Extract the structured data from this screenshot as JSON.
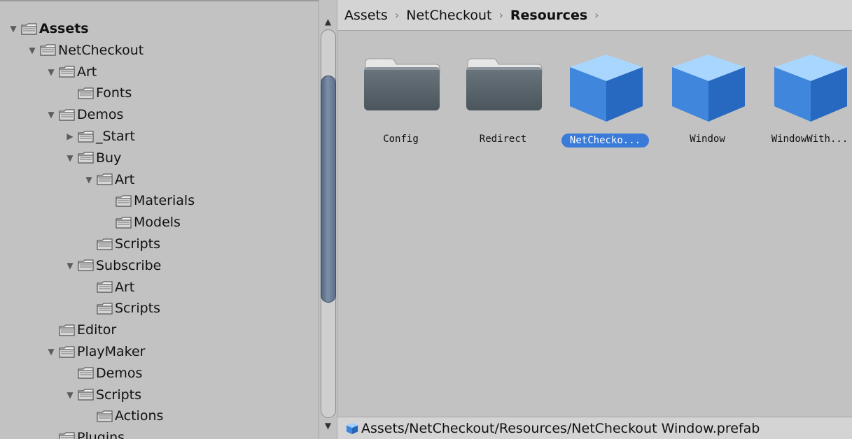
{
  "tree": {
    "items": [
      {
        "label": "Assets",
        "depth": 0,
        "expander": "expanded",
        "bold": true
      },
      {
        "label": "NetCheckout",
        "depth": 1,
        "expander": "expanded"
      },
      {
        "label": "Art",
        "depth": 2,
        "expander": "expanded"
      },
      {
        "label": "Fonts",
        "depth": 3,
        "expander": "none"
      },
      {
        "label": "Demos",
        "depth": 2,
        "expander": "expanded"
      },
      {
        "label": "_Start",
        "depth": 3,
        "expander": "collapsed"
      },
      {
        "label": "Buy",
        "depth": 3,
        "expander": "expanded"
      },
      {
        "label": "Art",
        "depth": 4,
        "expander": "expanded"
      },
      {
        "label": "Materials",
        "depth": 5,
        "expander": "none"
      },
      {
        "label": "Models",
        "depth": 5,
        "expander": "none"
      },
      {
        "label": "Scripts",
        "depth": 4,
        "expander": "none"
      },
      {
        "label": "Subscribe",
        "depth": 3,
        "expander": "expanded"
      },
      {
        "label": "Art",
        "depth": 4,
        "expander": "none"
      },
      {
        "label": "Scripts",
        "depth": 4,
        "expander": "none"
      },
      {
        "label": "Editor",
        "depth": 2,
        "expander": "none"
      },
      {
        "label": "PlayMaker",
        "depth": 2,
        "expander": "expanded"
      },
      {
        "label": "Demos",
        "depth": 3,
        "expander": "none"
      },
      {
        "label": "Scripts",
        "depth": 3,
        "expander": "expanded"
      },
      {
        "label": "Actions",
        "depth": 4,
        "expander": "none"
      },
      {
        "label": "Plugins",
        "depth": 2,
        "expander": "none"
      }
    ]
  },
  "breadcrumb": {
    "items": [
      {
        "label": "Assets",
        "current": false
      },
      {
        "label": "NetCheckout",
        "current": false
      },
      {
        "label": "Resources",
        "current": true
      }
    ],
    "separator": "›"
  },
  "assets": [
    {
      "label": "Config",
      "icon": "folder-icon",
      "selected": false
    },
    {
      "label": "Redirect",
      "icon": "folder-icon",
      "selected": false
    },
    {
      "label": "NetChecko...",
      "icon": "prefab-cube-icon",
      "selected": true
    },
    {
      "label": "Window",
      "icon": "prefab-cube-icon",
      "selected": false
    },
    {
      "label": "WindowWith...",
      "icon": "prefab-cube-icon",
      "selected": false
    }
  ],
  "status": {
    "path": "Assets/NetCheckout/Resources/NetCheckout Window.prefab",
    "icon": "prefab-cube-icon"
  },
  "scrollbar": {
    "up_glyph": "▲",
    "down_glyph": "▼"
  },
  "colors": {
    "panel_bg": "#c2c2c2",
    "bar_bg": "#d4d4d4",
    "selection": "#3a7ad9",
    "folder_dark": "#5a646c",
    "cube_blue": "#4a8fe0",
    "scroll_thumb": "#6b7d96"
  }
}
